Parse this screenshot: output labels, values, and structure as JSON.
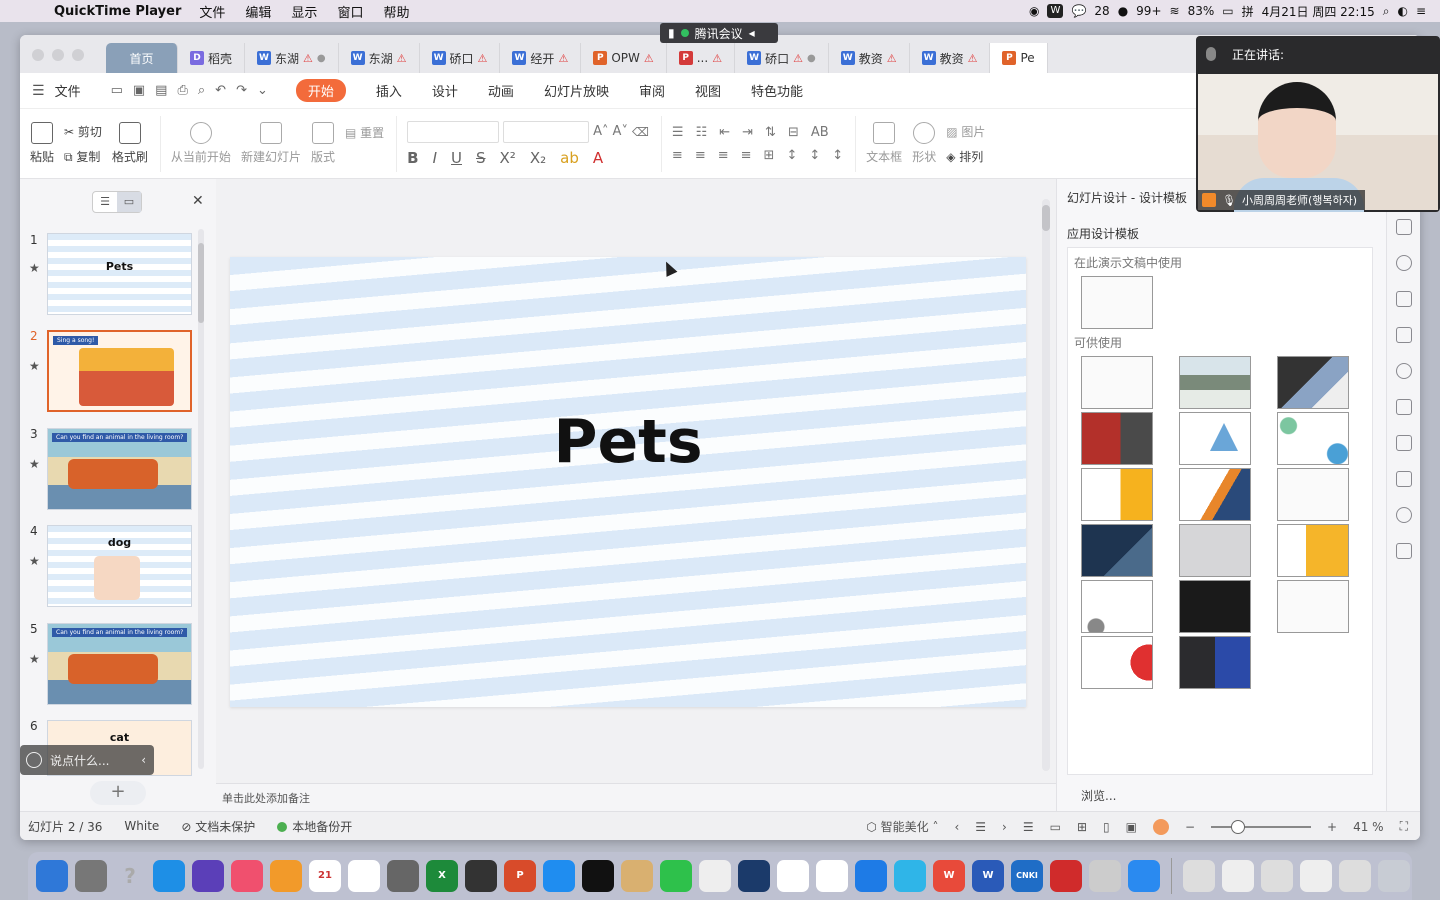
{
  "menubar": {
    "app_name": "QuickTime Player",
    "menus": [
      "文件",
      "编辑",
      "显示",
      "窗口",
      "帮助"
    ],
    "wechat_count": "28",
    "badge_count": "99+",
    "battery": "83%",
    "datetime": "4月21日 周四  22:15"
  },
  "meeting": {
    "app_label": "腾讯会议",
    "speaking_label": "正在讲话:",
    "speaker_name": "小周周周老师(행복하자)"
  },
  "tabs": [
    {
      "label": "首页",
      "type": "home"
    },
    {
      "label": "稻壳",
      "type": "d"
    },
    {
      "label": "东湖",
      "type": "w",
      "warn": true,
      "dot": true
    },
    {
      "label": "东湖",
      "type": "w",
      "warn": true
    },
    {
      "label": "硚口",
      "type": "w",
      "warn": true
    },
    {
      "label": "经开",
      "type": "w",
      "warn": true
    },
    {
      "label": "OPW",
      "type": "p",
      "warn": true
    },
    {
      "label": "...",
      "type": "r",
      "warn": true
    },
    {
      "label": "硚口",
      "type": "w",
      "warn": true,
      "dot": true
    },
    {
      "label": "教资",
      "type": "w",
      "warn": true
    },
    {
      "label": "教资",
      "type": "w",
      "warn": true
    },
    {
      "label": "Pe",
      "type": "p"
    }
  ],
  "menu": {
    "file": "文件",
    "items": [
      "开始",
      "插入",
      "设计",
      "动画",
      "幻灯片放映",
      "审阅",
      "视图",
      "特色功能"
    ]
  },
  "ribbon": {
    "paste": "粘贴",
    "cut": "剪切",
    "copy": "复制",
    "format_painter": "格式刷",
    "from_current": "从当前开始",
    "new_slide": "新建幻灯片",
    "layout": "版式",
    "reset": "重置",
    "textbox": "文本框",
    "shape": "形状",
    "picture": "图片",
    "arrange": "排列"
  },
  "slides": [
    {
      "num": "1",
      "title": "Pets",
      "kind": "title"
    },
    {
      "num": "2",
      "title": "Sing a song!",
      "kind": "song",
      "selected": true
    },
    {
      "num": "3",
      "title": "Can you find an animal in the living room?",
      "kind": "room"
    },
    {
      "num": "4",
      "title": "dog",
      "kind": "dog"
    },
    {
      "num": "5",
      "title": "Can you find an animal in the living room?",
      "kind": "room"
    },
    {
      "num": "6",
      "title": "cat",
      "kind": "cat"
    }
  ],
  "chat_placeholder": "说点什么...",
  "canvas": {
    "slide_title": "Pets",
    "notes_placeholder": "单击此处添加备注"
  },
  "design_panel": {
    "title": "幻灯片设计 - 设计模板",
    "apply_label": "应用设计模板",
    "in_use_label": "在此演示文稿中使用",
    "available_label": "可供使用",
    "browse": "浏览...",
    "templates": [
      "sketch",
      "mount",
      "city",
      "red",
      "tri",
      "dots",
      "yel",
      "navy",
      "sketch",
      "blue",
      "grey",
      "yel2",
      "circ",
      "black",
      "sketch",
      "pie",
      "bluewin"
    ]
  },
  "status": {
    "slide_info": "幻灯片 2 / 36",
    "theme": "White",
    "protect": "文档未保护",
    "backup": "本地备份开",
    "beautify": "智能美化",
    "zoom": "41 %"
  }
}
